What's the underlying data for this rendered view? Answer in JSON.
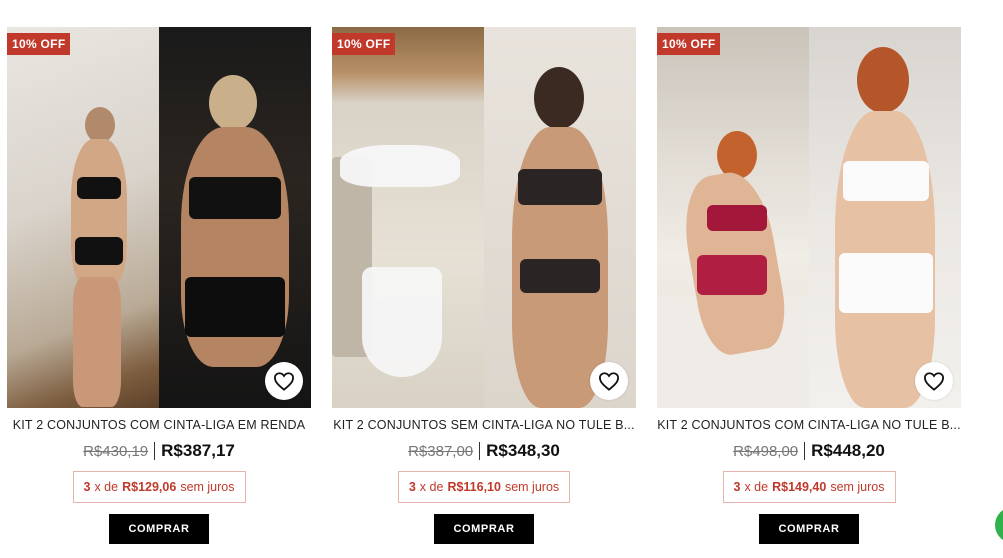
{
  "products": [
    {
      "badge": "10% OFF",
      "title": "KIT 2 CONJUNTOS COM CINTA-LIGA EM RENDA",
      "old_price": "R$430,19",
      "price": "R$387,17",
      "installments": {
        "count": "3",
        "x": "x de",
        "value": "R$129,06",
        "note": "sem juros"
      },
      "buy_label": "COMPRAR",
      "image_alt": "Modelos usando conjuntos pretos de renda com cinta-liga"
    },
    {
      "badge": "10% OFF",
      "title": "KIT 2 CONJUNTOS SEM CINTA-LIGA NO TULE B...",
      "old_price": "R$387,00",
      "price": "R$348,30",
      "installments": {
        "count": "3",
        "x": "x de",
        "value": "R$116,10",
        "note": "sem juros"
      },
      "buy_label": "COMPRAR",
      "image_alt": "Conjunto branco de tule sobre cadeira e modelo com conjunto preto"
    },
    {
      "badge": "10% OFF",
      "title": "KIT 2 CONJUNTOS COM CINTA-LIGA NO TULE B...",
      "old_price": "R$498,00",
      "price": "R$448,20",
      "installments": {
        "count": "3",
        "x": "x de",
        "value": "R$149,40",
        "note": "sem juros"
      },
      "buy_label": "COMPRAR",
      "image_alt": "Modelos com conjuntos vinho e branco com cinta-liga"
    }
  ],
  "colors": {
    "badge": "#c0392b",
    "installment_text": "#c0392b",
    "installment_border": "#e7b3ad",
    "button": "#000000",
    "whatsapp_edge": "#2fb24c"
  },
  "icons": [
    "heart-icon"
  ]
}
